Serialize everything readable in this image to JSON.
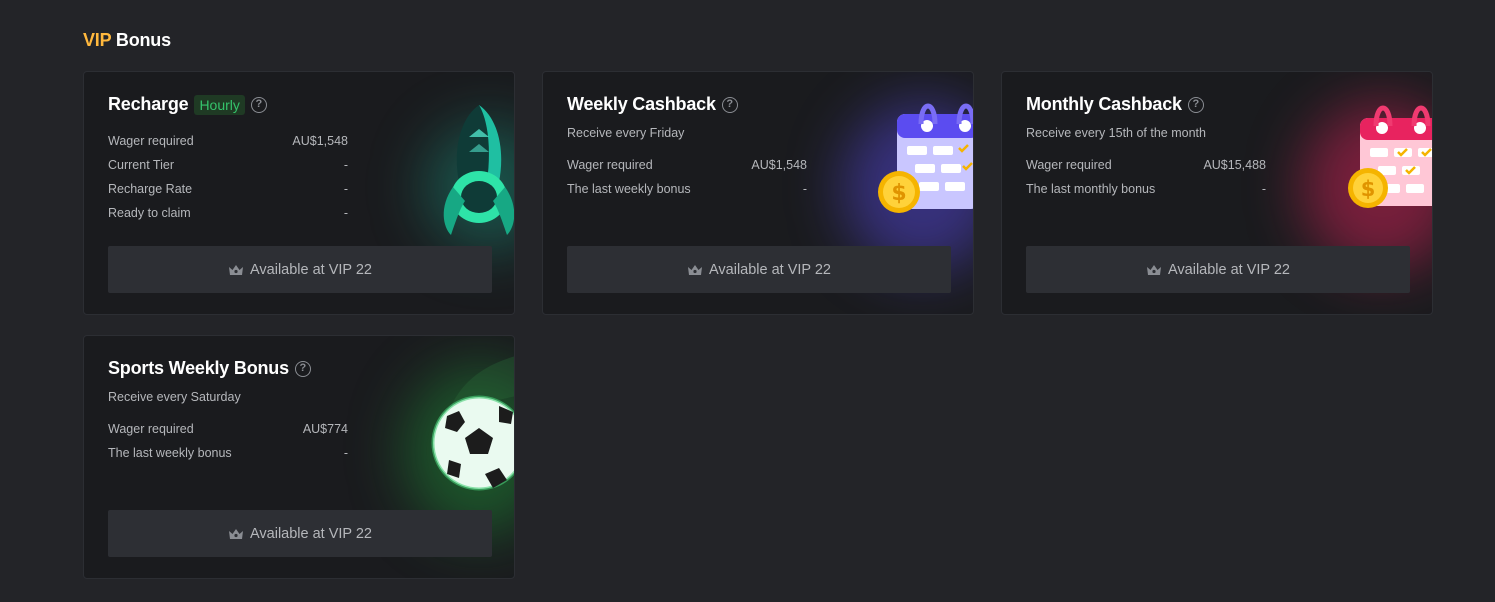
{
  "section": {
    "title_highlight": "VIP",
    "title_rest": "Bonus"
  },
  "cards": [
    {
      "title": "Recharge",
      "badge": "Hourly",
      "subtitle": "",
      "rows": [
        {
          "label": "Wager required",
          "value": "AU$1,548"
        },
        {
          "label": "Current Tier",
          "value": "-"
        },
        {
          "label": "Recharge Rate",
          "value": "-"
        },
        {
          "label": "Ready to claim",
          "value": "-"
        }
      ],
      "action_label": "Available at VIP 22",
      "illustration": "rocket-icon",
      "accent": "#1ab394"
    },
    {
      "title": "Weekly Cashback",
      "subtitle": "Receive every Friday",
      "rows": [
        {
          "label": "Wager required",
          "value": "AU$1,548"
        },
        {
          "label": "The last weekly bonus",
          "value": "-"
        }
      ],
      "action_label": "Available at VIP 22",
      "illustration": "calendar-coin-icon",
      "accent": "#5b4cf0"
    },
    {
      "title": "Monthly Cashback",
      "subtitle": "Receive every 15th of the month",
      "rows": [
        {
          "label": "Wager required",
          "value": "AU$15,488"
        },
        {
          "label": "The last monthly bonus",
          "value": "-"
        }
      ],
      "action_label": "Available at VIP 22",
      "illustration": "calendar-coin-icon",
      "accent": "#e8235f"
    },
    {
      "title": "Sports Weekly Bonus",
      "subtitle": "Receive every Saturday",
      "rows": [
        {
          "label": "Wager required",
          "value": "AU$774"
        },
        {
          "label": "The last weekly bonus",
          "value": "-"
        }
      ],
      "action_label": "Available at VIP 22",
      "illustration": "soccer-ball-icon",
      "accent": "#1f9a3a"
    }
  ]
}
